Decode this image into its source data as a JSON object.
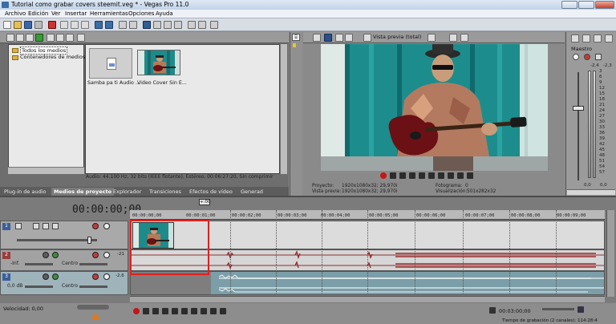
{
  "window": {
    "title": "Tutorial como grabar covers steemit.veg * - Vegas Pro 11.0"
  },
  "menu": [
    "Archivo",
    "Edición",
    "Ver",
    "Insertar",
    "Herramientas",
    "Opciones",
    "Ayuda"
  ],
  "explorer": {
    "tree": [
      "Todos los medios",
      "Contenedores de medios"
    ],
    "media_items": [
      {
        "name": "Samba pa ti Audio ...",
        "kind": "audio"
      },
      {
        "name": "Video Cover Sin E...",
        "kind": "video"
      }
    ],
    "info": "Audio: 44.100 Hz, 32 bits (IEEE flotante), Estéreo, 00:06:27:20, Sin comprimir",
    "tabs": [
      "Plug-in de audio",
      "Medios de proyecto",
      "Explorador",
      "Transiciones",
      "Efectos de vídeo",
      "Generad"
    ],
    "active_tab": "Medios de proyecto"
  },
  "preview": {
    "mode": "Vista previa (total)",
    "info": {
      "proyecto_label": "Proyecto:",
      "proyecto": "1920x1080x32; 29,970i",
      "vista_label": "Vista previa:",
      "vista": "1920x1080x32; 29,970i",
      "fotograma_label": "Fotograma:",
      "fotograma": "0",
      "visual_label": "Visualización:",
      "visual": "501x282x32"
    }
  },
  "master": {
    "label": "Maestro",
    "values": [
      "-2,4",
      "-2,3"
    ],
    "scale": [
      "3",
      "6",
      "9",
      "12",
      "15",
      "18",
      "21",
      "24",
      "27",
      "30",
      "33",
      "36",
      "39",
      "42",
      "45",
      "48",
      "51",
      "54",
      "57"
    ],
    "readout": [
      "0,0",
      "0,0"
    ]
  },
  "timeline": {
    "timecode": "00:00:00;00",
    "marker": "+:00",
    "ruler": [
      "00:00:00;00",
      "00:00:01;00",
      "00:00:02;00",
      "00:00:03;00",
      "00:00:04;00",
      "00:00:05;00",
      "00:00:06;00",
      "00:00:07;00",
      "00:00:08;00",
      "00:00:09;00"
    ],
    "track1": {
      "num": "1"
    },
    "track2": {
      "num": "2",
      "vol": "-Inf.",
      "pan": "Centro",
      "meter": "-21"
    },
    "track3": {
      "num": "3",
      "vol": "0,0 dB",
      "pan": "Centro",
      "meter": "-2,6"
    },
    "velocidad": "Velocidad: 0,00",
    "status_time": "00:03:00;00",
    "bottom_text": "Tiempo de grabación (2 canales): 114:28:4"
  }
}
